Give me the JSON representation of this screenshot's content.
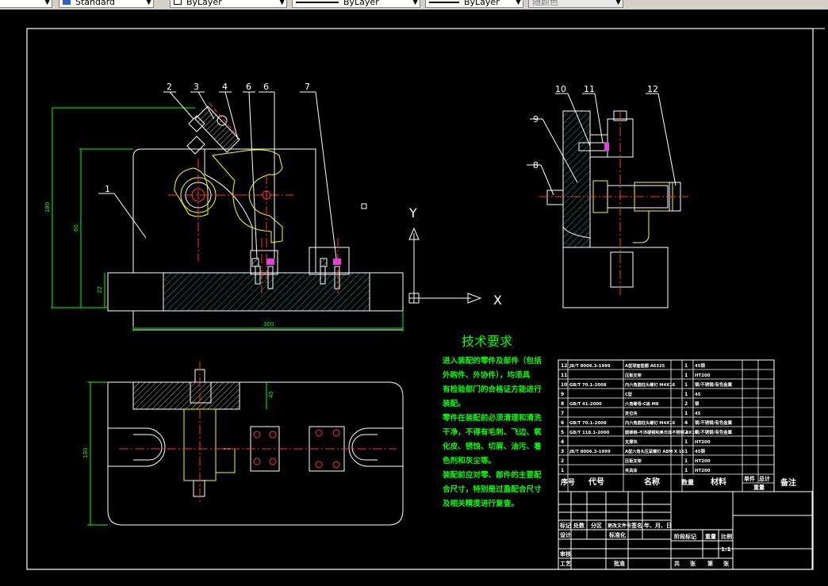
{
  "toolbar": {
    "textstyle": "Standard",
    "layer_color": "ByLayer",
    "linetype": "ByLayer",
    "lineweight": "ByLayer",
    "plotstyle": "随颜色"
  },
  "part_numbers": [
    "1",
    "2",
    "3",
    "4",
    "6",
    "6",
    "7",
    "8",
    "9",
    "10",
    "11",
    "12"
  ],
  "dimensions": {
    "height_total": "180",
    "height_inner": "60",
    "height_base": "22",
    "width_total": "300",
    "bottom_depth": "45",
    "bottom_height": "130"
  },
  "axis_labels": {
    "y": "Y",
    "x": "X"
  },
  "tech_requirements": {
    "title": "技术要求",
    "lines": [
      "进入装配的零件及部件（包括",
      "外购件、外协件），均须具",
      "有检验部门的合格证方能进行",
      "装配。",
      "零件在装配前必须清理和清洗",
      "干净，不得有毛刺、飞边、氧",
      "化皮、锈蚀、切屑、油污、着",
      "色剂和灰尘等。",
      "装配前应对零、部件的主要配",
      "合尺寸，特别是过盈配合尺寸",
      "及相关精度进行复查。"
    ]
  },
  "bom": {
    "rows": [
      {
        "no": "12",
        "code": "JB/T 8006.3-1999",
        "name": "A型球面垫圈 A6325",
        "qty": "1",
        "mat": "45钢"
      },
      {
        "no": "11",
        "code": "",
        "name": "压板支架",
        "qty": "1",
        "mat": "HT200"
      },
      {
        "no": "10",
        "code": "GB/T 70.1-2008",
        "name": "内六角圆柱头螺钉 M4X16",
        "qty": "1",
        "mat": "钢/不锈钢/有色金属"
      },
      {
        "no": "9",
        "code": "",
        "name": "C型",
        "qty": "1",
        "mat": "45"
      },
      {
        "no": "8",
        "code": "GB/T 41-2000",
        "name": "六角螺母-C级 M8",
        "qty": "2",
        "mat": "钢"
      },
      {
        "no": "7",
        "code": "",
        "name": "定位块",
        "qty": "1",
        "mat": "45"
      },
      {
        "no": "6",
        "code": "GB/T 70.1-2008",
        "name": "内六角圆柱头螺钉 M4X16",
        "qty": "4",
        "mat": "钢/不锈钢/有色金属"
      },
      {
        "no": "5",
        "code": "GB/T 118.1-2000",
        "name": "圆锥销-不淬硬钢和奥氏体不锈钢 4X16",
        "qty": "2",
        "mat": "钢/不锈钢/有色金属"
      },
      {
        "no": "4",
        "code": "",
        "name": "支撑块",
        "qty": "1",
        "mat": "HT200"
      },
      {
        "no": "3",
        "code": "JB/T 8006.3-1999",
        "name": "A型六角头压紧螺钉 A8M X 16",
        "qty": "1",
        "mat": "45钢"
      },
      {
        "no": "2",
        "code": "",
        "name": "压板支架",
        "qty": "1",
        "mat": "HT200"
      },
      {
        "no": "1",
        "code": "",
        "name": "夹具体",
        "qty": "1",
        "mat": "HT200"
      }
    ],
    "header": {
      "no": "序号",
      "code": "代号",
      "name": "名称",
      "qty": "数量",
      "mat": "材料",
      "w1": "单件",
      "w2": "总计",
      "w3": "重量",
      "note": "备注"
    }
  },
  "title_block": {
    "row1": [
      "标记",
      "处数",
      "分区",
      "更改文件号",
      "签名",
      "年、月、日"
    ],
    "design": "设计",
    "std": "标准化",
    "stage": "阶段标记",
    "weight": "重量",
    "scale": "比例",
    "scale_val": "1:1",
    "check": "审核",
    "craft": "工艺",
    "approve": "批准",
    "sheets": [
      "共",
      "张",
      "第",
      "张"
    ]
  }
}
